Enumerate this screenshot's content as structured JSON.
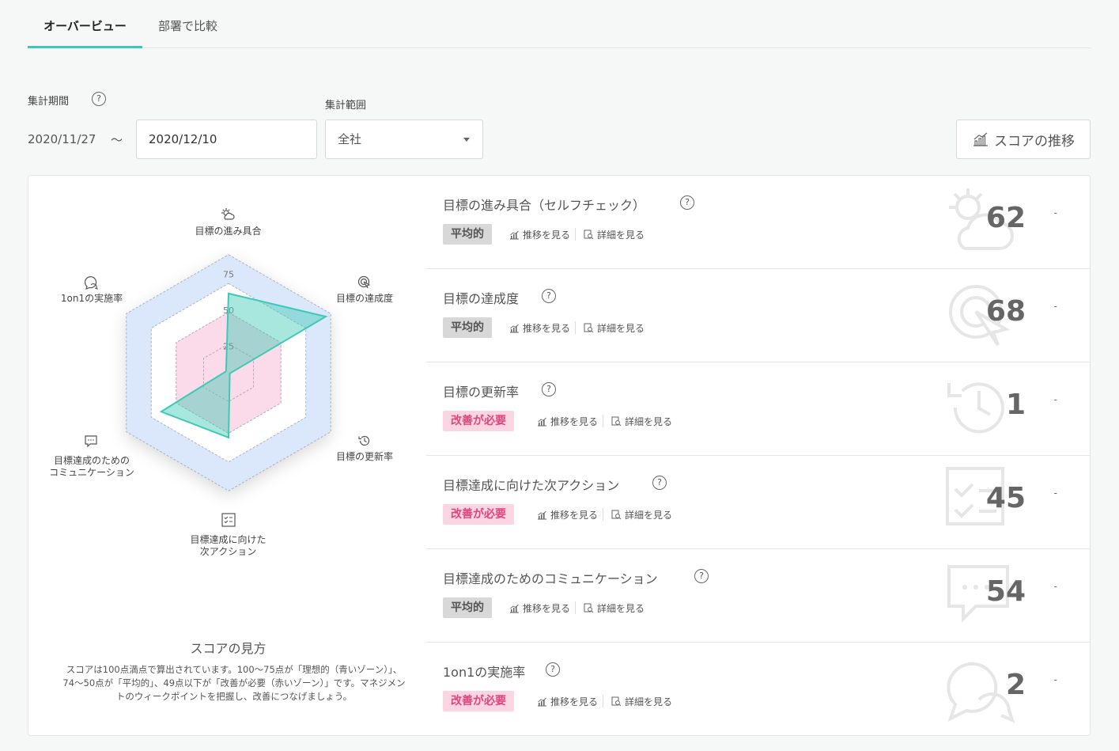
{
  "tabs": [
    {
      "label": "オーバービュー"
    },
    {
      "label": "部署で比較"
    }
  ],
  "filters": {
    "period_label": "集計期間",
    "help": "?",
    "start_date": "2020/11/27",
    "separator": "〜",
    "end_date": "2020/12/10",
    "scope_label": "集計範囲",
    "scope_value": "全社"
  },
  "trend_button": {
    "label": "スコアの推移",
    "icon": "chart-icon"
  },
  "radar": {
    "ticks": [
      "75",
      "50",
      "25"
    ],
    "axes": [
      {
        "label": "目標の進み具合",
        "icon": "weather-icon",
        "value": 55
      },
      {
        "label": "目標の達成度",
        "icon": "target-cursor-icon",
        "value": 78
      },
      {
        "label": "目標の更新率",
        "icon": "history-icon",
        "value": 1
      },
      {
        "label": "目標達成に向けた次アクション",
        "label_lines": [
          "目標達成に向けた",
          "次アクション"
        ],
        "icon": "checklist-icon",
        "value": 45
      },
      {
        "label": "目標達成のためのコミュニケーション",
        "label_lines": [
          "目標達成のための",
          "コミュニケーション"
        ],
        "icon": "chat-icon",
        "value": 54
      },
      {
        "label": "1on1の実施率",
        "icon": "conversation-icon",
        "value": 2
      }
    ],
    "zones": {
      "ideal_color": "#dbe8fb",
      "average_color": "#ffffff",
      "bad_color": "#fbdbe9",
      "series_color": "#3ec9b6"
    }
  },
  "howto": {
    "title": "スコアの見方",
    "text": "スコアは100点満点で算出されています。100〜75点が「理想的（青いゾーン）」、74〜50点が「平均的」、49点以下が「改善が必要（赤いゾーン）」です。マネジメントのウィークポイントを把握し、改善につなげましょう。"
  },
  "actions": {
    "trend": "推移を見る",
    "detail": "詳細を見る"
  },
  "metrics": [
    {
      "title": "目標の進み具合（セルフチェック）",
      "badge": "平均的",
      "badge_type": "avg",
      "score": "62",
      "change": "-",
      "icon": "weather-icon"
    },
    {
      "title": "目標の達成度",
      "badge": "平均的",
      "badge_type": "avg",
      "score": "68",
      "change": "-",
      "icon": "target-cursor-icon"
    },
    {
      "title": "目標の更新率",
      "badge": "改善が必要",
      "badge_type": "bad",
      "score": "1",
      "change": "-",
      "icon": "history-icon"
    },
    {
      "title": "目標達成に向けた次アクション",
      "badge": "改善が必要",
      "badge_type": "bad",
      "score": "45",
      "change": "-",
      "icon": "checklist-icon"
    },
    {
      "title": "目標達成のためのコミュニケーション",
      "badge": "平均的",
      "badge_type": "avg",
      "score": "54",
      "change": "-",
      "icon": "chat-icon"
    },
    {
      "title": "1on1の実施率",
      "badge": "改善が必要",
      "badge_type": "bad",
      "score": "2",
      "change": "-",
      "icon": "conversation-icon"
    }
  ]
}
